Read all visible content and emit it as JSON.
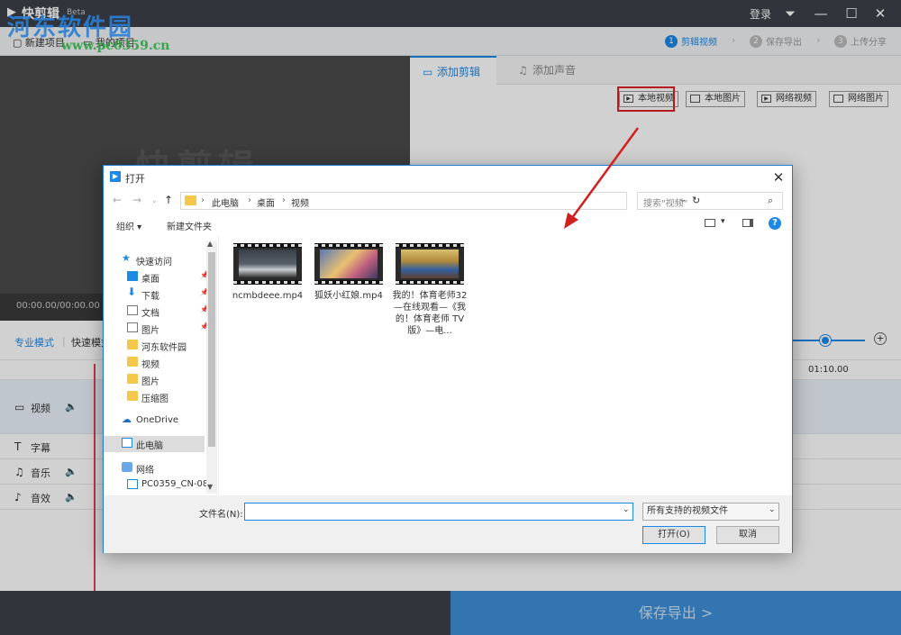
{
  "app": {
    "name": "快剪辑",
    "badge": "Beta",
    "login": "登录",
    "toolbar": {
      "new_project": "新建项目",
      "my_projects": "我的项目"
    },
    "steps": [
      {
        "num": "1",
        "label": "剪辑视频"
      },
      {
        "num": "2",
        "label": "保存导出"
      },
      {
        "num": "3",
        "label": "上传分享"
      }
    ],
    "preview": {
      "timecode": "00:00.00/00:00.00",
      "watermark": "快剪辑"
    },
    "tabs": {
      "add_clip": "添加剪辑",
      "add_audio": "添加声音"
    },
    "source_buttons": {
      "local_video": "本地视频",
      "local_image": "本地图片",
      "web_video": "网络视频",
      "web_image": "网络图片"
    },
    "modes": {
      "pro": "专业模式",
      "quick": "快速模式"
    },
    "ruler_time": "01:10.00",
    "tracks": {
      "video": "视频",
      "subtitle": "字幕",
      "music": "音乐",
      "sfx": "音效"
    },
    "export": "保存导出 >"
  },
  "site_watermark": {
    "title": "河东软件园",
    "url": "www.pc0359.cn"
  },
  "dialog": {
    "title": "打开",
    "breadcrumb": [
      "此电脑",
      "桌面",
      "视频"
    ],
    "search_placeholder": "搜索\"视频\"",
    "commands": {
      "organize": "组织 ▾",
      "new_folder": "新建文件夹"
    },
    "nav": {
      "quick_access": "快速访问",
      "desktop": "桌面",
      "downloads": "下载",
      "documents": "文档",
      "pictures": "图片",
      "hedong": "河东软件园",
      "videos": "视频",
      "pictures2": "图片",
      "compress": "压缩图",
      "onedrive": "OneDrive",
      "this_pc": "此电脑",
      "network": "网络",
      "pc_name": "PC0359_CN-08"
    },
    "files": [
      {
        "name": "ncmbdeee.mp4",
        "thumb_color": "#55606a"
      },
      {
        "name": "狐妖小红娘.mp4",
        "thumb_color": "#6b5a8a"
      },
      {
        "name": "我的！体育老师32—在线观看—《我的！体育老师 TV版》—电...",
        "thumb_color": "#b08a3a"
      }
    ],
    "filename_label": "文件名(N):",
    "filename_value": "",
    "filetype": "所有支持的视频文件",
    "open": "打开(O)",
    "cancel": "取消"
  },
  "colors": {
    "accent": "#1e88e5",
    "highlight": "#e02020",
    "titlebar": "#3c4048",
    "export": "#3d8fd8"
  }
}
